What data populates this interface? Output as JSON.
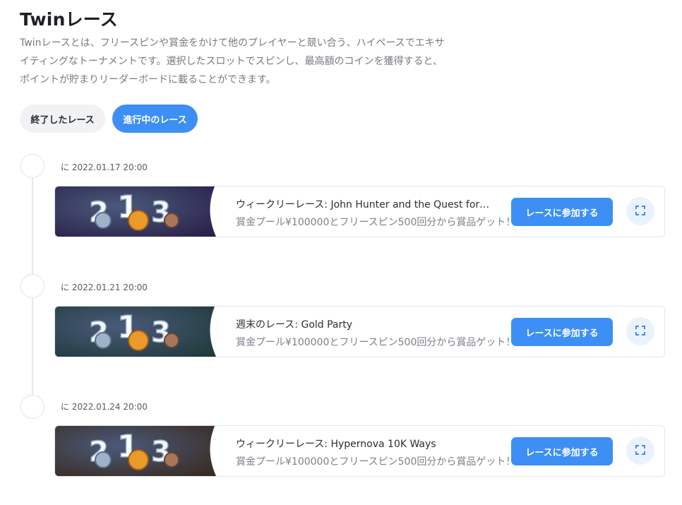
{
  "page": {
    "title": "Twinレース",
    "description_lines": [
      "Twinレースとは、フリースピンや賞金をかけて他のプレイヤーと競い合う、ハイペースでエキサ",
      "イティングなトーナメントです。選択したスロットでスピンし、最高額のコインを獲得すると、",
      "ポイントが貯まりリーダーボードに載ることができます。"
    ]
  },
  "tabs": [
    {
      "label": "終了したレース",
      "active": false
    },
    {
      "label": "進行中のレース",
      "active": true
    }
  ],
  "races": [
    {
      "date": "に 2022.01.17 20:00",
      "title": "ウィークリーレース: John Hunter and the Quest for ...",
      "subtitle": "賞金プール¥100000とフリースピン500回分から賞品ゲット！",
      "join_label": "レースに参加する",
      "thumb_numbers": [
        "2",
        "1",
        "3"
      ],
      "thumb_bg": "#2a1f4a"
    },
    {
      "date": "に 2022.01.21 20:00",
      "title": "週末のレース: Gold Party",
      "subtitle": "賞金プール¥100000とフリースピン500回分から賞品ゲット！",
      "join_label": "レースに参加する",
      "thumb_numbers": [
        "2",
        "1",
        "3"
      ],
      "thumb_bg": "#1f3a3a"
    },
    {
      "date": "に 2022.01.24 20:00",
      "title": "ウィークリーレース: Hypernova 10K Ways",
      "subtitle": "賞金プール¥100000とフリースピン500回分から賞品ゲット！",
      "join_label": "レースに参加する",
      "thumb_numbers": [
        "2",
        "1",
        "3"
      ],
      "thumb_bg": "#3a2a1f"
    }
  ],
  "colors": {
    "accent": "#3d8ff5",
    "tab_inactive_bg": "#f1f2f4"
  },
  "icons": {
    "expand": "fullscreen-expand-icon"
  }
}
